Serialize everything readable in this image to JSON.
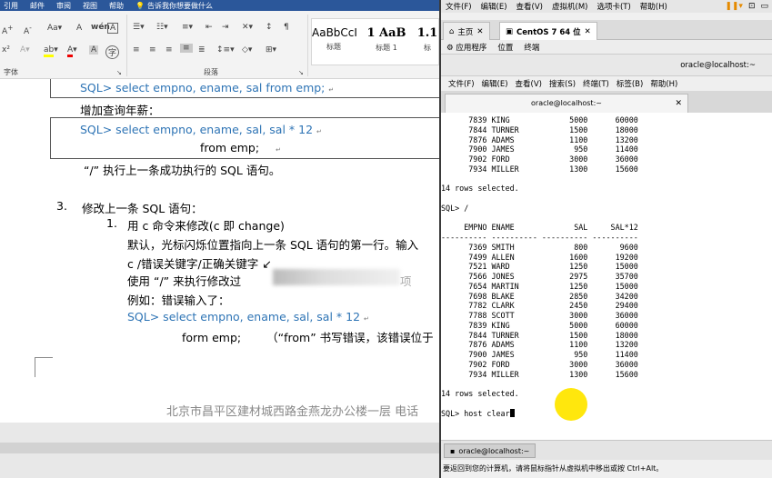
{
  "word": {
    "tabs": [
      "引用",
      "邮件",
      "审阅",
      "视图",
      "帮助"
    ],
    "tell_me": "告诉我你想要做什么",
    "ribbon": {
      "font_group_label": "字体",
      "paragraph_group_label": "段落",
      "styles": [
        {
          "preview": "AaBbCcI",
          "name": "标题"
        },
        {
          "preview": "1 AaB",
          "name": "标题 1"
        },
        {
          "preview": "1.1",
          "name": "标"
        }
      ]
    },
    "doc": {
      "line1": "SQL> select empno, ename, sal from emp;",
      "line2": "增加查询年薪：",
      "line3": "SQL>   select empno, ename, sal, sal * 12",
      "line4": "from emp;",
      "line5": "“/” 执行上一条成功执行的 SQL 语句。",
      "num3": "3.",
      "line6": "修改上一条 SQL 语句：",
      "num1": "1.",
      "line7": "用 c 命令来修改(c  即  change)",
      "line8": "默认，光标闪烁位置指向上一条 SQL 语句的第一行。输入",
      "line9": "c    /错误关键字/正确关键字  ↙",
      "line10": "使用 “/” 来执行修改过",
      "line10b": "项",
      "line11": "例如：错误输入了：",
      "line12": "SQL> select empno, ename, sal, sal * 12",
      "line13a": "form emp;",
      "line13b": "（“from” 书写错误，该错误位于",
      "footer": "北京市昌平区建材城西路金燕龙办公楼一层      电话"
    }
  },
  "vm": {
    "menu": [
      "文件(F)",
      "编辑(E)",
      "查看(V)",
      "虚拟机(M)",
      "选项卡(T)",
      "帮助(H)"
    ],
    "tabs": {
      "home": "主页",
      "active": "CentOS 7 64 位"
    },
    "gnome_bar": [
      "应用程序",
      "位置",
      "终端"
    ],
    "window_title": "oracle@localhost:~",
    "term_menu": [
      "文件(F)",
      "编辑(E)",
      "查看(V)",
      "搜索(S)",
      "终端(T)",
      "标签(B)",
      "帮助(H)"
    ],
    "term_tab_title": "oracle@localhost:~",
    "terminal_text": "      7839 KING             5000      60000\n      7844 TURNER           1500      18000\n      7876 ADAMS            1100      13200\n      7900 JAMES             950      11400\n      7902 FORD             3000      36000\n      7934 MILLER           1300      15600\n\n14 rows selected.\n\nSQL> /\n\n     EMPNO ENAME             SAL     SAL*12\n---------- ---------- ---------- ----------\n      7369 SMITH             800       9600\n      7499 ALLEN            1600      19200\n      7521 WARD             1250      15000\n      7566 JONES            2975      35700\n      7654 MARTIN           1250      15000\n      7698 BLAKE            2850      34200\n      7782 CLARK            2450      29400\n      7788 SCOTT            3000      36000\n      7839 KING             5000      60000\n      7844 TURNER           1500      18000\n      7876 ADAMS            1100      13200\n      7900 JAMES             950      11400\n      7902 FORD             3000      36000\n      7934 MILLER           1300      15600\n\n14 rows selected.\n\nSQL> host clear",
    "taskbar_item": "oracle@localhost:~",
    "status": "要返回到您的计算机，请将鼠标指针从虚拟机中移出或按 Ctrl+Alt。",
    "colors": {
      "highlight": "#ffe600",
      "word_blue": "#2b579a",
      "sql_blue": "#2e74b5"
    }
  }
}
